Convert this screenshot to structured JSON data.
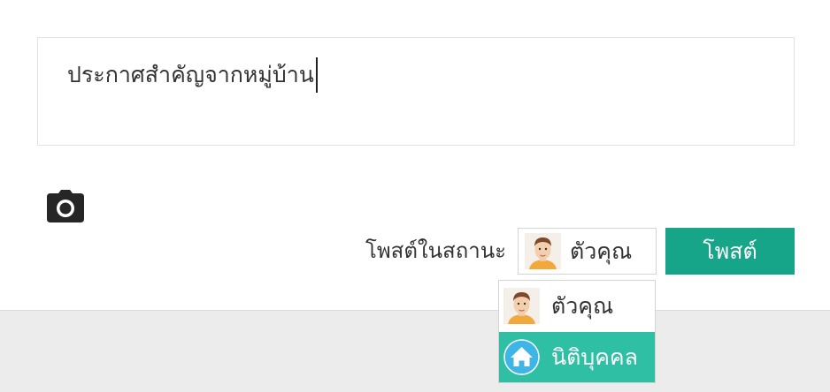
{
  "composer": {
    "text_value": "ประกาศสำคัญจากหมู่บ้าน",
    "camera_icon": "camera-icon"
  },
  "post_as": {
    "label": "โพสต์ในสถานะ",
    "selected_name": "ตัวคุณ",
    "selected_icon": "user-avatar"
  },
  "post_button": {
    "label": "โพสต์",
    "color": "#17a589"
  },
  "dropdown": {
    "options": [
      {
        "name": "ตัวคุณ",
        "icon": "user-avatar",
        "highlighted": false
      },
      {
        "name": "นิติบุคคล",
        "icon": "home-icon",
        "highlighted": true
      }
    ],
    "highlight_color": "#2fbfa5"
  }
}
